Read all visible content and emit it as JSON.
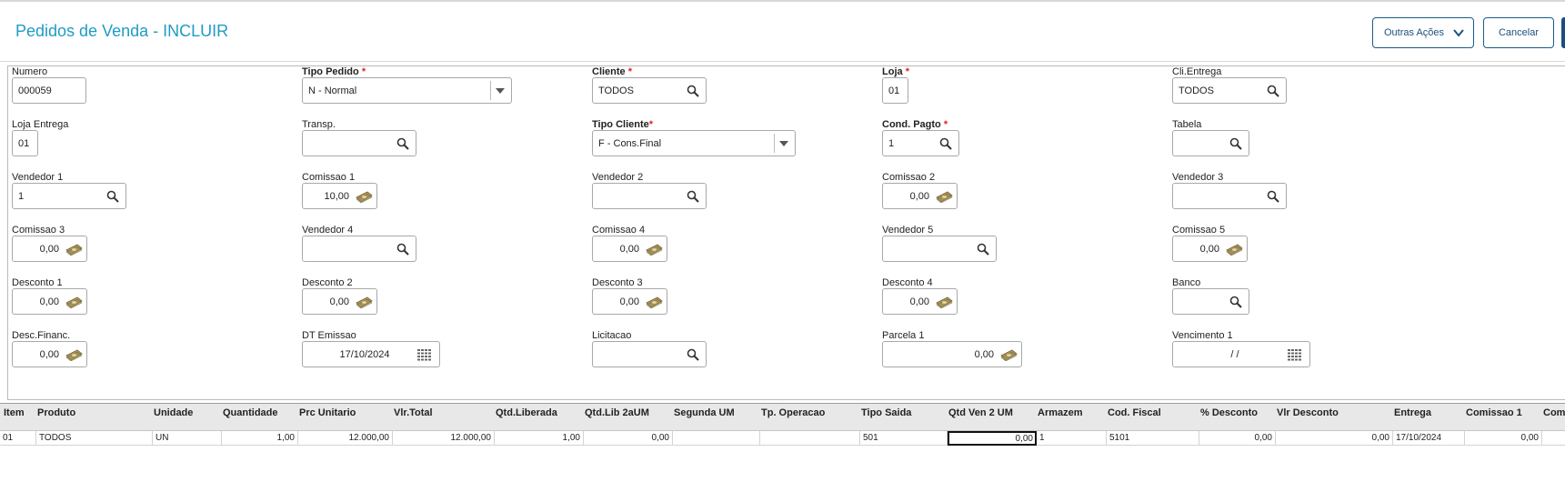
{
  "header": {
    "title": "Pedidos de Venda - INCLUIR",
    "outras_acoes": "Outras Ações",
    "cancelar": "Cancelar"
  },
  "fields": {
    "numero": {
      "label": "Numero",
      "value": "000059"
    },
    "tipo_pedido": {
      "label": "Tipo Pedido",
      "value": "N - Normal"
    },
    "cliente": {
      "label": "Cliente",
      "value": "TODOS"
    },
    "loja": {
      "label": "Loja",
      "value": "01"
    },
    "cli_entrega": {
      "label": "Cli.Entrega",
      "value": "TODOS"
    },
    "loja_entrega": {
      "label": "Loja Entrega",
      "value": "01"
    },
    "transp": {
      "label": "Transp.",
      "value": ""
    },
    "tipo_cliente": {
      "label": "Tipo Cliente",
      "value": "F - Cons.Final"
    },
    "cond_pagto": {
      "label": "Cond. Pagto",
      "value": "1"
    },
    "tabela": {
      "label": "Tabela",
      "value": ""
    },
    "vendedor1": {
      "label": "Vendedor 1",
      "value": "1"
    },
    "comissao1": {
      "label": "Comissao 1",
      "value": "10,00"
    },
    "vendedor2": {
      "label": "Vendedor 2",
      "value": ""
    },
    "comissao2": {
      "label": "Comissao 2",
      "value": "0,00"
    },
    "vendedor3": {
      "label": "Vendedor 3",
      "value": ""
    },
    "comissao3": {
      "label": "Comissao 3",
      "value": "0,00"
    },
    "vendedor4": {
      "label": "Vendedor 4",
      "value": ""
    },
    "comissao4": {
      "label": "Comissao 4",
      "value": "0,00"
    },
    "vendedor5": {
      "label": "Vendedor 5",
      "value": ""
    },
    "comissao5": {
      "label": "Comissao 5",
      "value": "0,00"
    },
    "desconto1": {
      "label": "Desconto 1",
      "value": "0,00"
    },
    "desconto2": {
      "label": "Desconto 2",
      "value": "0,00"
    },
    "desconto3": {
      "label": "Desconto 3",
      "value": "0,00"
    },
    "desconto4": {
      "label": "Desconto 4",
      "value": "0,00"
    },
    "banco": {
      "label": "Banco",
      "value": ""
    },
    "desc_financ": {
      "label": "Desc.Financ.",
      "value": "0,00"
    },
    "dt_emissao": {
      "label": "DT Emissao",
      "value": "17/10/2024"
    },
    "licitacao": {
      "label": "Licitacao",
      "value": ""
    },
    "parcela1": {
      "label": "Parcela 1",
      "value": "0,00"
    },
    "vencimento1": {
      "label": "Vencimento 1",
      "value": "/ /"
    }
  },
  "grid": {
    "headers": [
      "Item",
      "Produto",
      "Unidade",
      "Quantidade",
      "Prc Unitario",
      "Vlr.Total",
      "Qtd.Liberada",
      "Qtd.Lib 2aUM",
      "Segunda UM",
      "Tp. Operacao",
      "Tipo Saida",
      "Qtd Ven 2 UM",
      "Armazem",
      "Cod. Fiscal",
      "% Desconto",
      "Vlr Desconto",
      "Entrega",
      "Comissao 1",
      "Com"
    ],
    "row": [
      "01",
      "TODOS",
      "UN",
      "1,00",
      "12.000,00",
      "12.000,00",
      "1,00",
      "0,00",
      "",
      "",
      "501",
      "0,00",
      "1",
      "5101",
      "0,00",
      "0,00",
      "17/10/2024",
      "0,00",
      ""
    ]
  },
  "colors": {
    "title": "#1f9cc4",
    "button_border": "#1a5b8a",
    "required": "#dd2222"
  }
}
